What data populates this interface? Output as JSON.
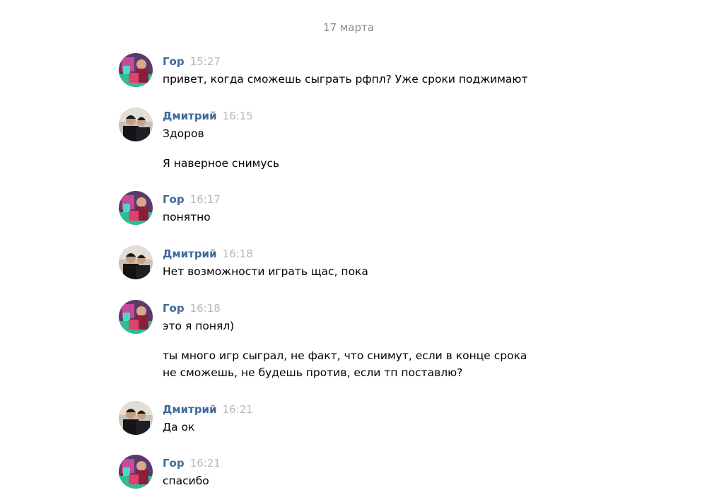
{
  "date_separator": "17 марта",
  "messages": [
    {
      "author": "Гор",
      "time": "15:27",
      "lines": [
        "привет, когда сможешь сыграть рфпл? Уже сроки поджимают"
      ]
    },
    {
      "author": "Дмитрий",
      "time": "16:15",
      "lines": [
        "Здоров",
        "Я наверное снимусь"
      ]
    },
    {
      "author": "Гор",
      "time": "16:17",
      "lines": [
        "понятно"
      ]
    },
    {
      "author": "Дмитрий",
      "time": "16:18",
      "lines": [
        "Нет возможности играть щас, пока"
      ]
    },
    {
      "author": "Гор",
      "time": "16:18",
      "lines": [
        "это я понял)",
        "ты много игр сыграл, не факт, что снимут, если в конце срока",
        "не сможешь, не будешь против, если тп поставлю?"
      ]
    },
    {
      "author": "Дмитрий",
      "time": "16:21",
      "lines": [
        "Да ок"
      ]
    },
    {
      "author": "Гор",
      "time": "16:21",
      "lines": [
        "спасибо"
      ]
    }
  ]
}
